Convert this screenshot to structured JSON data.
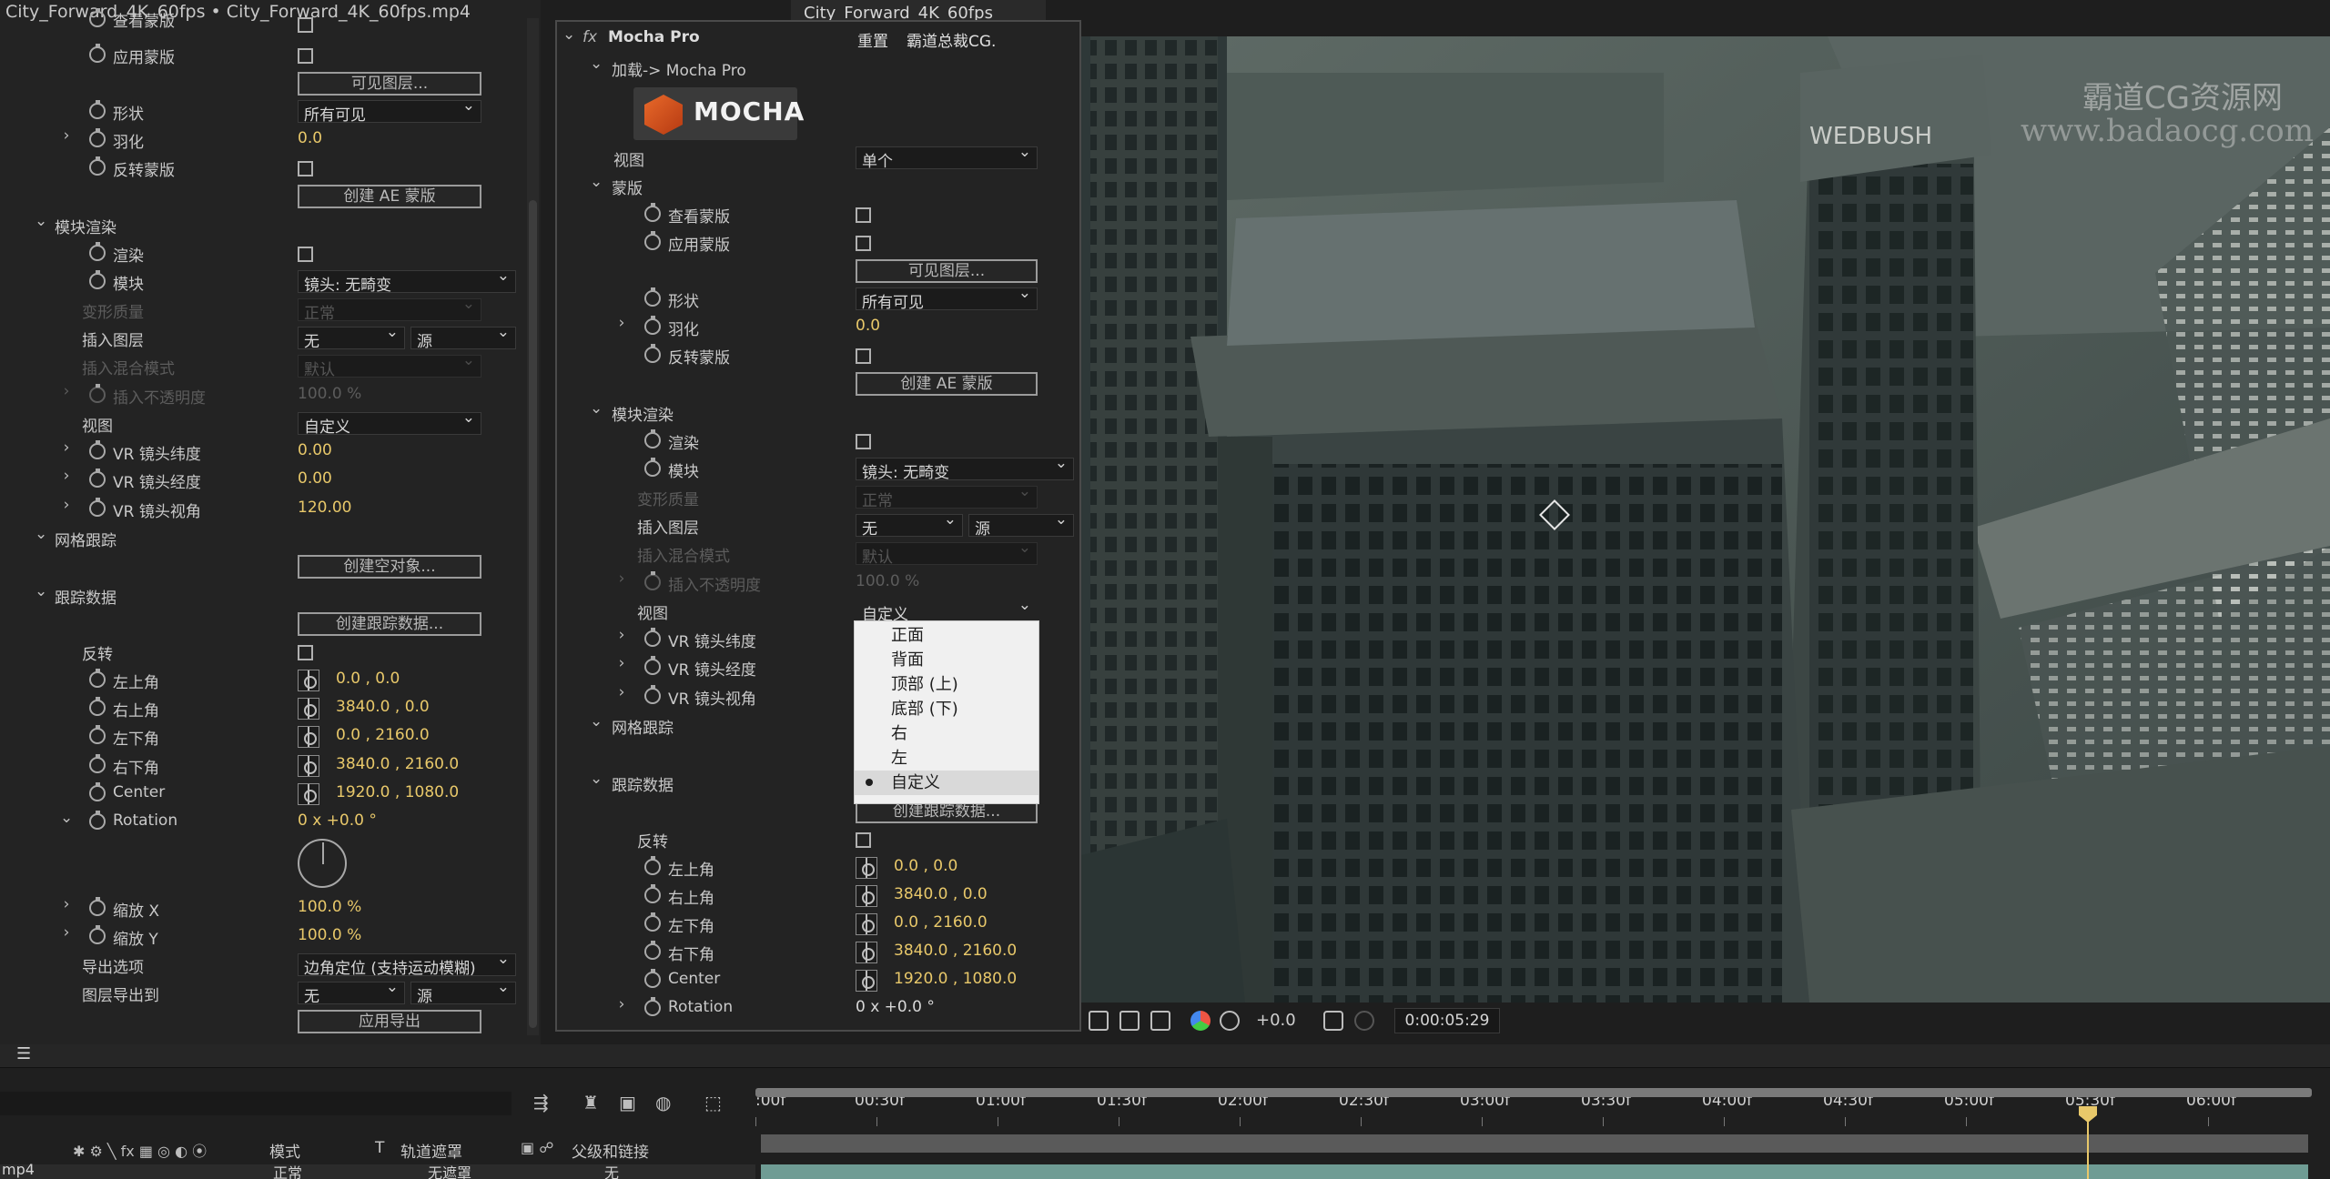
{
  "window_title": "City_Forward_4K_60fps • City_Forward_4K_60fps.mp4",
  "viewer_tab": "City_Forward_4K_60fps",
  "watermark": {
    "line1": "霸道CG资源网",
    "line2": "www.badaocg.com"
  },
  "building_sign": "WEDBUSH",
  "left_panel": {
    "items": {
      "top_partial": "查看蒙版",
      "apply_mask": "应用蒙版",
      "visible_layers_btn": "可见图层...",
      "shape": "形状",
      "shape_value": "所有可见",
      "feather": "羽化",
      "feather_value": "0.0",
      "invert_mask": "反转蒙版",
      "create_ae_mask_btn": "创建 AE 蒙版",
      "module_render": "模块渲染",
      "render": "渲染",
      "module": "模块",
      "module_value": "镜头: 无畸变",
      "warp_quality": "变形质量",
      "warp_quality_value": "正常",
      "insert_layer": "插入图层",
      "insert_layer_value": "无",
      "insert_source": "源",
      "insert_blend": "插入混合模式",
      "insert_blend_value": "默认",
      "insert_opacity": "插入不透明度",
      "insert_opacity_value": "100.0 %",
      "view": "视图",
      "view_value": "自定义",
      "vr_lat": "VR 镜头纬度",
      "vr_lat_value": "0.00",
      "vr_lon": "VR 镜头经度",
      "vr_lon_value": "0.00",
      "vr_fov": "VR 镜头视角",
      "vr_fov_value": "120.00",
      "mesh_track": "网格跟踪",
      "create_null_btn": "创建空对象...",
      "track_data": "跟踪数据",
      "create_track_btn": "创建跟踪数据...",
      "invert": "反转",
      "tl": "左上角",
      "tl_value": "0.0 , 0.0",
      "tr": "右上角",
      "tr_value": "3840.0 , 0.0",
      "bl": "左下角",
      "bl_value": "0.0 , 2160.0",
      "br": "右下角",
      "br_value": "3840.0 , 2160.0",
      "center": "Center",
      "center_value": "1920.0 , 1080.0",
      "rotation": "Rotation",
      "rotation_value": "0 x +0.0 °",
      "scale_x": "缩放 X",
      "scale_x_value": "100.0 %",
      "scale_y": "缩放 Y",
      "scale_y_value": "100.0 %",
      "export_option": "导出选项",
      "export_option_value": "边角定位 (支持运动模糊)",
      "layer_export_to": "图层导出到",
      "layer_export_value": "无",
      "layer_export_source": "源",
      "apply_export_btn": "应用导出"
    }
  },
  "mocha_panel": {
    "fx": "fx",
    "title": "Mocha Pro",
    "reset": "重置",
    "about": "霸道总裁CG.",
    "load": "加载-> Mocha Pro",
    "logo_text": "MOCHA",
    "view": "视图",
    "view_value": "单个",
    "mask": "蒙版",
    "view_mask": "查看蒙版",
    "apply_mask": "应用蒙版",
    "visible_layers_btn": "可见图层...",
    "shape": "形状",
    "shape_value": "所有可见",
    "feather": "羽化",
    "feather_value": "0.0",
    "invert_mask": "反转蒙版",
    "create_ae_mask_btn": "创建 AE 蒙版",
    "module_render": "模块渲染",
    "render": "渲染",
    "module": "模块",
    "module_value": "镜头: 无畸变",
    "warp_quality": "变形质量",
    "warp_quality_value": "正常",
    "insert_layer": "插入图层",
    "insert_layer_value": "无",
    "insert_source": "源",
    "insert_blend": "插入混合模式",
    "insert_blend_value": "默认",
    "insert_opacity": "插入不透明度",
    "insert_opacity_value": "100.0 %",
    "view2": "视图",
    "view2_value": "自定义",
    "vr_lat": "VR 镜头纬度",
    "vr_lon": "VR 镜头经度",
    "vr_fov": "VR 镜头视角",
    "mesh_track": "网格跟踪",
    "track_data": "跟踪数据",
    "create_track_btn": "创建跟踪数据...",
    "invert": "反转",
    "tl": "左上角",
    "tl_value": "0.0 , 0.0",
    "tr": "右上角",
    "tr_value": "3840.0 , 0.0",
    "bl": "左下角",
    "bl_value": "0.0 , 2160.0",
    "br": "右下角",
    "br_value": "3840.0 , 2160.0",
    "center": "Center",
    "center_value": "1920.0 , 1080.0",
    "rotation": "Rotation",
    "rotation_value": "0 x +0.0 °"
  },
  "view_menu": {
    "options": [
      "正面",
      "背面",
      "顶部 (上)",
      "底部 (下)",
      "右",
      "左",
      "自定义"
    ],
    "selected": "自定义"
  },
  "viewer_bar": {
    "exposure": "+0.0",
    "timecode": "0:00:05:29"
  },
  "timeline": {
    "ruler": [
      ":00f",
      "00:30f",
      "01:00f",
      "01:30f",
      "02:00f",
      "02:30f",
      "03:00f",
      "03:30f",
      "04:00f",
      "04:30f",
      "05:00f",
      "05:30f",
      "06:00f"
    ],
    "col_mode": "模式",
    "col_t": "T",
    "col_trkmat": "轨道遮罩",
    "col_parent": "父级和链接",
    "row_mode": "正常",
    "row_trkmat": "无遮罩",
    "row_parent": "无",
    "layer_name": "mp4"
  }
}
